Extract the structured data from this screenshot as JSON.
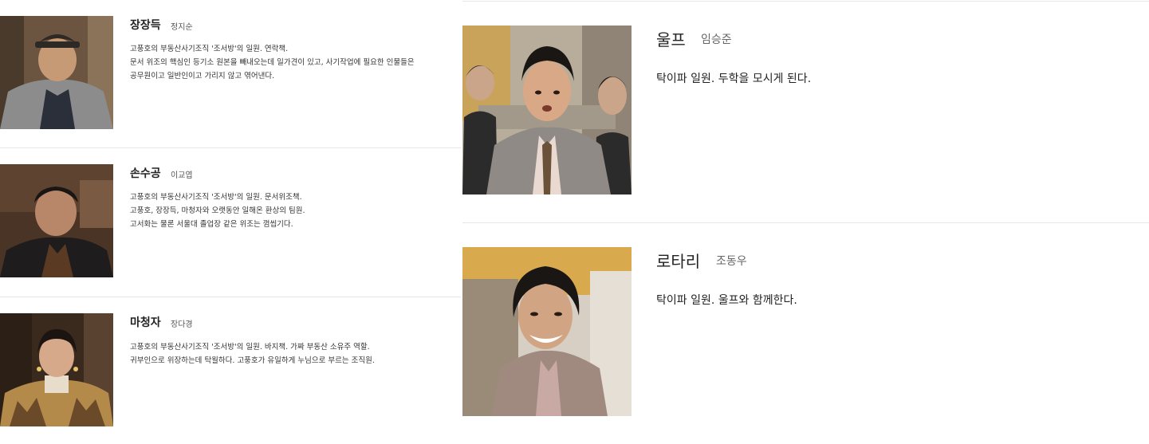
{
  "left_cast": [
    {
      "name": "장장득",
      "actor": "정지순",
      "lines": [
        "고풍호의 부동산사기조직 '조서방'의 일원. 연락책.",
        "문서 위조의 핵심인 등기소 원본을 빼내오는데 일가견이 있고, 사기작업에 필요한 인물들은",
        "공무원이고 일반인이고 가리지 않고 엮어낸다."
      ]
    },
    {
      "name": "손수공",
      "actor": "이교엽",
      "lines": [
        "고풍호의 부동산사기조직 '조서방'의 일원. 문서위조책.",
        "고풍호, 장장득, 마청자와 오랫동안 일해온 환상의 팀원.",
        "고서화는 물론 서울대 졸업장 같은 위조는 껌씹기다."
      ]
    },
    {
      "name": "마청자",
      "actor": "장다경",
      "lines": [
        "고풍호의 부동산사기조직 '조서방'의 일원. 바지책. 가짜 부동산 소유주 역할.",
        "귀부인으로 위장하는데 탁월하다. 고풍호가 유일하게 누님으로 부르는 조직원."
      ]
    }
  ],
  "right_cast": [
    {
      "name": "울프",
      "actor": "임승준",
      "description": "탁이파 일원. 두학을 모시게 된다."
    },
    {
      "name": "로타리",
      "actor": "조동우",
      "description": "탁이파 일원. 울프와 함께한다."
    }
  ]
}
